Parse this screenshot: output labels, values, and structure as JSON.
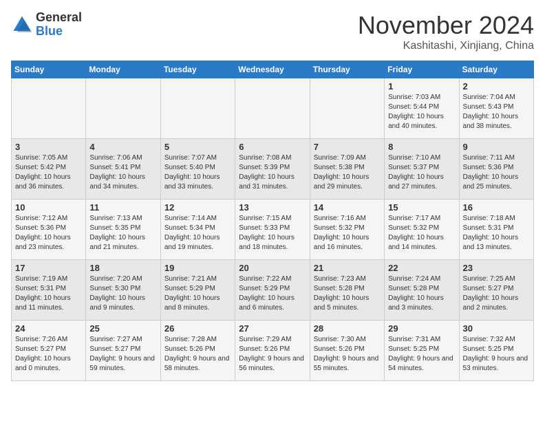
{
  "header": {
    "logo_general": "General",
    "logo_blue": "Blue",
    "title": "November 2024",
    "subtitle": "Kashitashi, Xinjiang, China"
  },
  "days_of_week": [
    "Sunday",
    "Monday",
    "Tuesday",
    "Wednesday",
    "Thursday",
    "Friday",
    "Saturday"
  ],
  "weeks": [
    [
      {
        "day": "",
        "detail": ""
      },
      {
        "day": "",
        "detail": ""
      },
      {
        "day": "",
        "detail": ""
      },
      {
        "day": "",
        "detail": ""
      },
      {
        "day": "",
        "detail": ""
      },
      {
        "day": "1",
        "detail": "Sunrise: 7:03 AM\nSunset: 5:44 PM\nDaylight: 10 hours and 40 minutes."
      },
      {
        "day": "2",
        "detail": "Sunrise: 7:04 AM\nSunset: 5:43 PM\nDaylight: 10 hours and 38 minutes."
      }
    ],
    [
      {
        "day": "3",
        "detail": "Sunrise: 7:05 AM\nSunset: 5:42 PM\nDaylight: 10 hours and 36 minutes."
      },
      {
        "day": "4",
        "detail": "Sunrise: 7:06 AM\nSunset: 5:41 PM\nDaylight: 10 hours and 34 minutes."
      },
      {
        "day": "5",
        "detail": "Sunrise: 7:07 AM\nSunset: 5:40 PM\nDaylight: 10 hours and 33 minutes."
      },
      {
        "day": "6",
        "detail": "Sunrise: 7:08 AM\nSunset: 5:39 PM\nDaylight: 10 hours and 31 minutes."
      },
      {
        "day": "7",
        "detail": "Sunrise: 7:09 AM\nSunset: 5:38 PM\nDaylight: 10 hours and 29 minutes."
      },
      {
        "day": "8",
        "detail": "Sunrise: 7:10 AM\nSunset: 5:37 PM\nDaylight: 10 hours and 27 minutes."
      },
      {
        "day": "9",
        "detail": "Sunrise: 7:11 AM\nSunset: 5:36 PM\nDaylight: 10 hours and 25 minutes."
      }
    ],
    [
      {
        "day": "10",
        "detail": "Sunrise: 7:12 AM\nSunset: 5:36 PM\nDaylight: 10 hours and 23 minutes."
      },
      {
        "day": "11",
        "detail": "Sunrise: 7:13 AM\nSunset: 5:35 PM\nDaylight: 10 hours and 21 minutes."
      },
      {
        "day": "12",
        "detail": "Sunrise: 7:14 AM\nSunset: 5:34 PM\nDaylight: 10 hours and 19 minutes."
      },
      {
        "day": "13",
        "detail": "Sunrise: 7:15 AM\nSunset: 5:33 PM\nDaylight: 10 hours and 18 minutes."
      },
      {
        "day": "14",
        "detail": "Sunrise: 7:16 AM\nSunset: 5:32 PM\nDaylight: 10 hours and 16 minutes."
      },
      {
        "day": "15",
        "detail": "Sunrise: 7:17 AM\nSunset: 5:32 PM\nDaylight: 10 hours and 14 minutes."
      },
      {
        "day": "16",
        "detail": "Sunrise: 7:18 AM\nSunset: 5:31 PM\nDaylight: 10 hours and 13 minutes."
      }
    ],
    [
      {
        "day": "17",
        "detail": "Sunrise: 7:19 AM\nSunset: 5:31 PM\nDaylight: 10 hours and 11 minutes."
      },
      {
        "day": "18",
        "detail": "Sunrise: 7:20 AM\nSunset: 5:30 PM\nDaylight: 10 hours and 9 minutes."
      },
      {
        "day": "19",
        "detail": "Sunrise: 7:21 AM\nSunset: 5:29 PM\nDaylight: 10 hours and 8 minutes."
      },
      {
        "day": "20",
        "detail": "Sunrise: 7:22 AM\nSunset: 5:29 PM\nDaylight: 10 hours and 6 minutes."
      },
      {
        "day": "21",
        "detail": "Sunrise: 7:23 AM\nSunset: 5:28 PM\nDaylight: 10 hours and 5 minutes."
      },
      {
        "day": "22",
        "detail": "Sunrise: 7:24 AM\nSunset: 5:28 PM\nDaylight: 10 hours and 3 minutes."
      },
      {
        "day": "23",
        "detail": "Sunrise: 7:25 AM\nSunset: 5:27 PM\nDaylight: 10 hours and 2 minutes."
      }
    ],
    [
      {
        "day": "24",
        "detail": "Sunrise: 7:26 AM\nSunset: 5:27 PM\nDaylight: 10 hours and 0 minutes."
      },
      {
        "day": "25",
        "detail": "Sunrise: 7:27 AM\nSunset: 5:27 PM\nDaylight: 9 hours and 59 minutes."
      },
      {
        "day": "26",
        "detail": "Sunrise: 7:28 AM\nSunset: 5:26 PM\nDaylight: 9 hours and 58 minutes."
      },
      {
        "day": "27",
        "detail": "Sunrise: 7:29 AM\nSunset: 5:26 PM\nDaylight: 9 hours and 56 minutes."
      },
      {
        "day": "28",
        "detail": "Sunrise: 7:30 AM\nSunset: 5:26 PM\nDaylight: 9 hours and 55 minutes."
      },
      {
        "day": "29",
        "detail": "Sunrise: 7:31 AM\nSunset: 5:25 PM\nDaylight: 9 hours and 54 minutes."
      },
      {
        "day": "30",
        "detail": "Sunrise: 7:32 AM\nSunset: 5:25 PM\nDaylight: 9 hours and 53 minutes."
      }
    ]
  ]
}
